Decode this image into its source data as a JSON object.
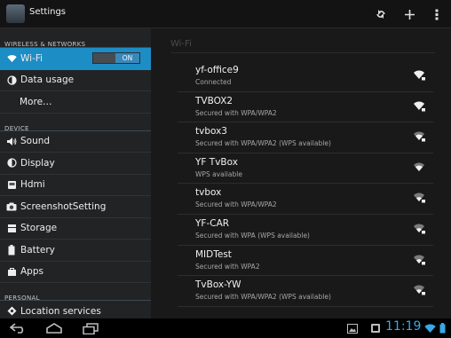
{
  "header": {
    "title": "Settings",
    "actions": [
      "refresh-icon",
      "add-icon",
      "overflow-menu-icon"
    ]
  },
  "sidebar": {
    "sections": [
      {
        "header": "WIRELESS & NETWORKS",
        "items": [
          {
            "label": "Wi-Fi",
            "icon": "wifi-icon",
            "toggle": "ON",
            "active": true
          },
          {
            "label": "Data usage",
            "icon": "data-usage-icon"
          },
          {
            "label": "More…",
            "icon": ""
          }
        ]
      },
      {
        "header": "DEVICE",
        "items": [
          {
            "label": "Sound",
            "icon": "speaker-icon"
          },
          {
            "label": "Display",
            "icon": "brightness-icon"
          },
          {
            "label": "Hdmi",
            "icon": "hdmi-icon"
          },
          {
            "label": "ScreenshotSetting",
            "icon": "camera-icon"
          },
          {
            "label": "Storage",
            "icon": "storage-icon"
          },
          {
            "label": "Battery",
            "icon": "battery-icon"
          },
          {
            "label": "Apps",
            "icon": "apps-icon"
          }
        ]
      },
      {
        "header": "PERSONAL",
        "items": [
          {
            "label": "Location services",
            "icon": "location-icon"
          }
        ]
      }
    ]
  },
  "content": {
    "title": "Wi-Fi",
    "networks": [
      {
        "name": "yf-office9",
        "status": "Connected",
        "secured": true
      },
      {
        "name": "TVBOX2",
        "status": "Secured with WPA/WPA2",
        "secured": true
      },
      {
        "name": "tvbox3",
        "status": "Secured with WPA/WPA2 (WPS available)",
        "secured": true
      },
      {
        "name": "YF TvBox",
        "status": "WPS available",
        "secured": false
      },
      {
        "name": "tvbox",
        "status": "Secured with WPA/WPA2",
        "secured": true
      },
      {
        "name": "YF-CAR",
        "status": "Secured with WPA (WPS available)",
        "secured": true
      },
      {
        "name": "MIDTest",
        "status": "Secured with WPA2",
        "secured": true
      },
      {
        "name": "TvBox-YW",
        "status": "Secured with WPA/WPA2 (WPS available)",
        "secured": true
      }
    ]
  },
  "statusbar": {
    "clock": "11:19",
    "nav_buttons": [
      "back-icon",
      "home-icon",
      "recent-apps-icon"
    ],
    "accent_color": "#37a8e8"
  },
  "colors": {
    "highlight": "#1d8dc5"
  }
}
